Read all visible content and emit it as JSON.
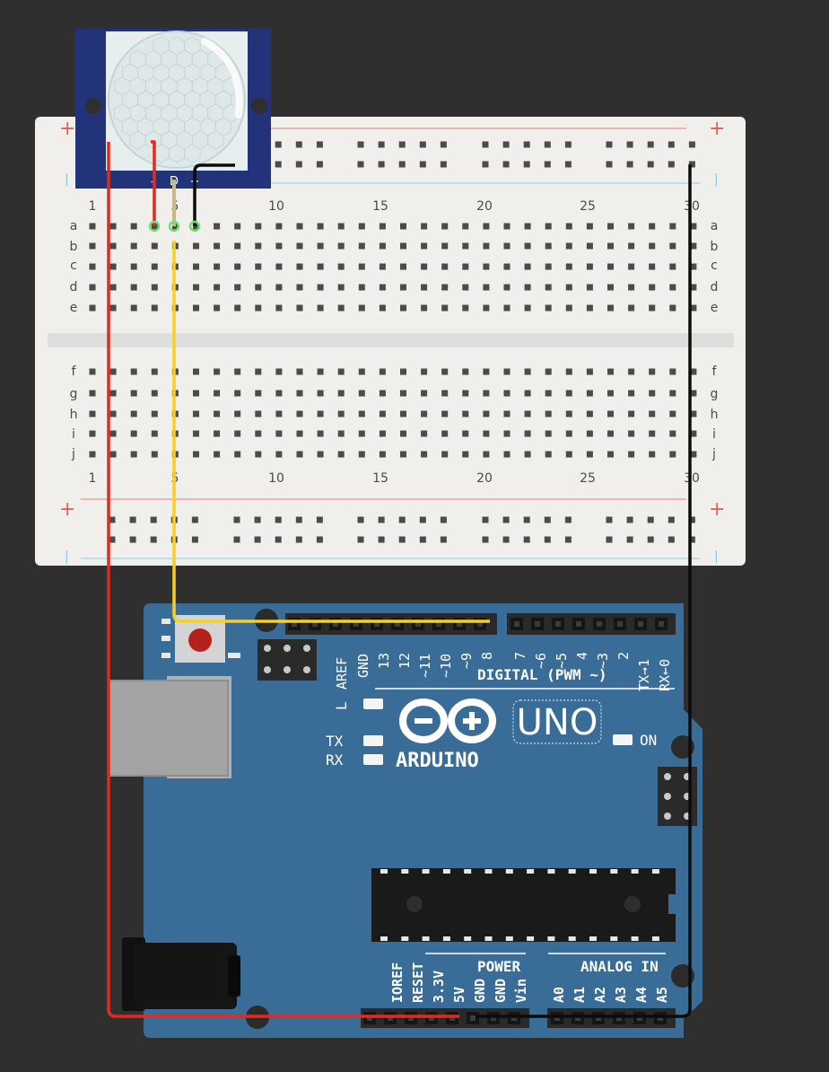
{
  "colors": {
    "background": "#2f2f2f",
    "breadboard": "#f0efec",
    "hole": "#4b4b4b",
    "rail_red": "#e8a39c",
    "rail_blue": "#a9d7ee",
    "arduino": "#3a6c98",
    "sensor_pcb": "#22337a",
    "wire_red": "#e22a1f",
    "wire_yellow": "#f5d02b",
    "wire_black": "#0c0c0c"
  },
  "breadboard": {
    "rail_plus": "+",
    "rail_minus": "|",
    "column_numbers": [
      "1",
      "5",
      "10",
      "15",
      "20",
      "25",
      "30"
    ],
    "rows_top": [
      "a",
      "b",
      "c",
      "d",
      "e"
    ],
    "rows_bottom": [
      "f",
      "g",
      "h",
      "i",
      "j"
    ]
  },
  "pir_sensor": {
    "pin_labels": [
      "–",
      "D",
      "+"
    ]
  },
  "arduino": {
    "brand": "ARDUINO",
    "model": "UNO",
    "digital_header_label": "DIGITAL (PWM ~)",
    "digital_pins": [
      "AREF",
      "GND",
      "13",
      "12",
      "~11",
      "~10",
      "~9",
      "8",
      "7",
      "~6",
      "~5",
      "4",
      "~3",
      "2",
      "TX→1",
      "RX←0"
    ],
    "led_labels": {
      "l": "L",
      "tx": "TX",
      "rx": "RX",
      "on": "ON"
    },
    "power_header_label": "POWER",
    "power_pins": [
      "IOREF",
      "RESET",
      "3.3V",
      "5V",
      "GND",
      "GND",
      "Vin"
    ],
    "analog_header_label": "ANALOG IN",
    "analog_pins": [
      "A0",
      "A1",
      "A2",
      "A3",
      "A4",
      "A5"
    ]
  }
}
